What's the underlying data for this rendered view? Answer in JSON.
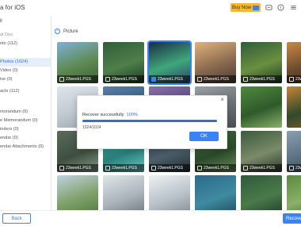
{
  "titlebar": {
    "title": "a for iOS",
    "buy_label": "Buy Now",
    "icons": [
      "cart-icon",
      "message-icon",
      "help-icon",
      "menu-icon"
    ]
  },
  "sidebar": {
    "all_label": "ll",
    "items": [
      {
        "label": "al Disc",
        "group": true
      },
      {
        "label": "nto (112)"
      },
      {
        "label": " Photos (1024)",
        "active": true
      },
      {
        "label": "Video (0)"
      },
      {
        "label": "ive (0)"
      },
      {
        "label": "acts (112)"
      },
      {
        "label": ""
      },
      {
        "label": "morandum (0)"
      },
      {
        "label": "e Memorandum (0)"
      },
      {
        "label": "inders (0)"
      },
      {
        "label": "endar (0)"
      },
      {
        "label": "endar Attachments (0)"
      }
    ]
  },
  "main": {
    "breadcrumb": "Picture",
    "rows": [
      [
        {
          "caption": "23week1.PGS",
          "selected": false,
          "colors": [
            "#7fb0d8",
            "#5e8a52",
            "#3c5f35"
          ]
        },
        {
          "caption": "23week1.PGS",
          "selected": false,
          "colors": [
            "#2f5d3a",
            "#4f7f4a",
            "#1d3a26"
          ]
        },
        {
          "caption": "23week1.PGS",
          "selected": true,
          "colors": [
            "#1a2b45",
            "#3fa77a",
            "#2b3f6a"
          ]
        },
        {
          "caption": "23week1.PGS",
          "selected": false,
          "colors": [
            "#e0b37a",
            "#8a6a4f",
            "#4a3b33"
          ]
        },
        {
          "caption": "23week1.PGS",
          "selected": false,
          "colors": [
            "#2f5b3a",
            "#6a8f3f",
            "#1e3b28"
          ]
        },
        {
          "caption": "23week1.PGS",
          "selected": false,
          "colors": [
            "#c98a46",
            "#6a4a2f",
            "#3a2a1f"
          ]
        }
      ],
      [
        {
          "caption": "",
          "selected": false,
          "colors": [
            "#dfe6ec",
            "#bfc9cf",
            "#9aa7ad"
          ]
        },
        {
          "caption": "",
          "selected": false,
          "colors": [
            "#5a7fa8",
            "#3a5f7f",
            "#2a4a63"
          ]
        },
        {
          "caption": "",
          "selected": false,
          "colors": [
            "#8a6fa8",
            "#5a4a7f",
            "#b09acb"
          ]
        },
        {
          "caption": "",
          "selected": false,
          "colors": [
            "#9aa0a6",
            "#6b7075",
            "#4b4f53"
          ]
        },
        {
          "caption": "",
          "selected": false,
          "colors": [
            "#4f8a3f",
            "#2f5a2a",
            "#8ab06a"
          ]
        },
        {
          "caption": "",
          "selected": false,
          "colors": [
            "#c9843a",
            "#2f4a2a",
            "#8a5a2a"
          ]
        }
      ],
      [
        {
          "caption": "23week1.PGS",
          "selected": false,
          "colors": [
            "#5a6b5a",
            "#3f4f3f",
            "#8a9a8a"
          ]
        },
        {
          "caption": "23week1.PGS",
          "selected": false,
          "colors": [
            "#3aa7a0",
            "#2a7f7a",
            "#6ac7c0"
          ]
        },
        {
          "caption": "23week1.PGS",
          "selected": false,
          "colors": [
            "#2f3f4a",
            "#4a5f6a",
            "#1f2a33"
          ]
        },
        {
          "caption": "23week1.PGS",
          "selected": false,
          "colors": [
            "#3f6a3a",
            "#2a4a2a",
            "#6a8a5a"
          ]
        },
        {
          "caption": "23week1.PGS",
          "selected": false,
          "colors": [
            "#3a5a3a",
            "#7a8a6a",
            "#2a3a2a"
          ]
        },
        {
          "caption": "23week1.PGS",
          "selected": false,
          "colors": [
            "#8aa0b0",
            "#5a6f7f",
            "#3a4a55"
          ]
        }
      ],
      [
        {
          "caption": "",
          "selected": false,
          "colors": [
            "#bfd3e0",
            "#7fa06a",
            "#4f7a3f"
          ]
        },
        {
          "caption": "",
          "selected": false,
          "colors": [
            "#dfe6ea",
            "#aab4ba",
            "#6a757a"
          ]
        },
        {
          "caption": "",
          "selected": false,
          "colors": [
            "#eef1f3",
            "#b8c2c8",
            "#7f8a90"
          ]
        },
        {
          "caption": "",
          "selected": false,
          "colors": [
            "#2a6a8a",
            "#3f8aa0",
            "#1f4a5f"
          ]
        },
        {
          "caption": "",
          "selected": false,
          "colors": [
            "#2f5a3a",
            "#4a7a4a",
            "#1f3a2a"
          ]
        },
        {
          "caption": "",
          "selected": false,
          "colors": [
            "#5a8a3f",
            "#8ab06a",
            "#3a5a2a"
          ]
        }
      ]
    ]
  },
  "modal": {
    "close_glyph": "×",
    "label": "Recover successfully",
    "percent_text": "100%",
    "progress": 1.0,
    "count": "1024/1024",
    "ok_label": "OK"
  },
  "footer": {
    "back_label": "Back",
    "recover_label": "Recove"
  },
  "colors": {
    "accent": "#3b82f6",
    "buy": "#f5b82e",
    "sidebar_active_bg": "#e6eefb"
  }
}
